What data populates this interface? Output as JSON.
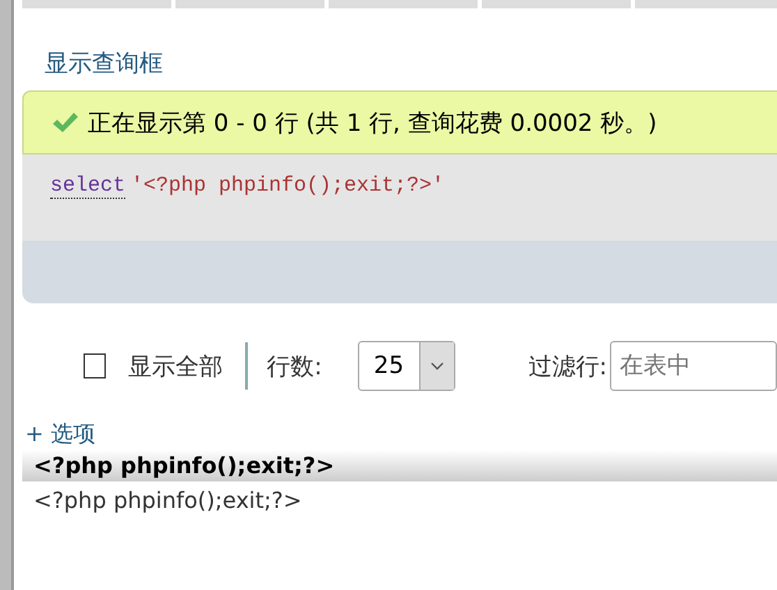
{
  "query_box_link": "显示查询框",
  "message": {
    "kind": "success",
    "text": "正在显示第 0 - 0 行 (共 1 行, 查询花费 0.0002 秒。)"
  },
  "sql": {
    "keyword": "select",
    "string": "'<?php phpinfo();exit;?>'"
  },
  "controls": {
    "show_all": {
      "label": "显示全部",
      "checked": false
    },
    "rows_label": "行数:",
    "rows_select": {
      "value": "25"
    },
    "filter_label": "过滤行:",
    "filter_input": {
      "placeholder": "在表中"
    }
  },
  "options_link": "+ 选项",
  "table": {
    "columns": [
      "<?php phpinfo();exit;?>"
    ],
    "rows": [
      [
        "<?php phpinfo();exit;?>"
      ]
    ]
  }
}
